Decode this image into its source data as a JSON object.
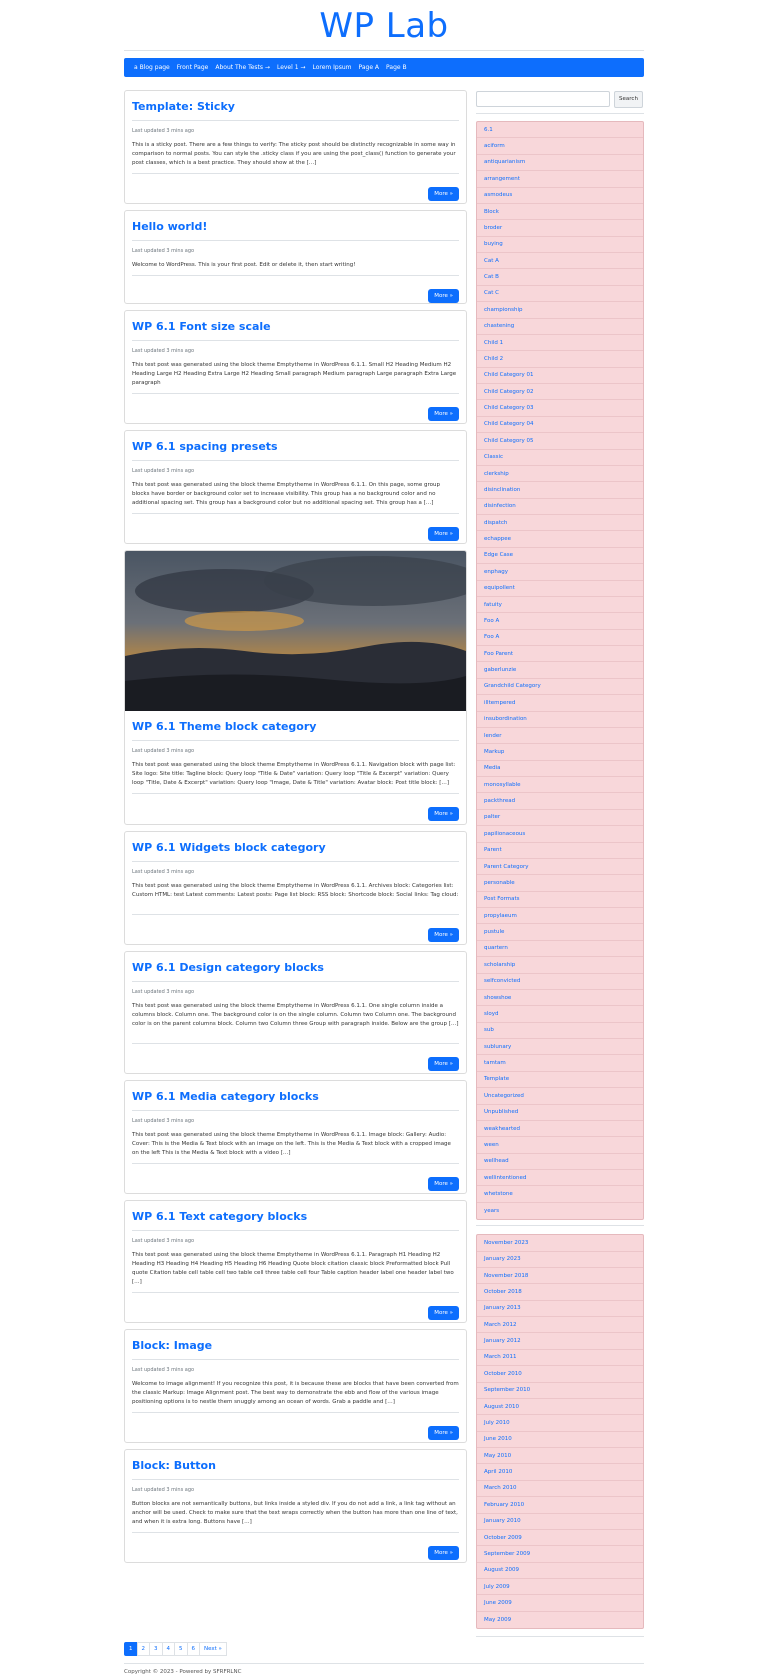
{
  "site": {
    "title": "WP Lab"
  },
  "nav": {
    "items": [
      "a Blog page",
      "Front Page",
      "About The Tests →",
      "Level 1 →",
      "Lorem Ipsum",
      "Page A",
      "Page B"
    ]
  },
  "posts": [
    {
      "title": "Template: Sticky",
      "meta": "Last updated 3 mins ago",
      "excerpt": "This is a sticky post. There are a few things to verify: The sticky post should be distinctly recognizable in some way in comparison to normal posts. You can style the .sticky class if you are using the post_class() function to generate your post classes, which is a best practice. They should show at the […]",
      "more": "More »"
    },
    {
      "title": "Hello world!",
      "meta": "Last updated 3 mins ago",
      "excerpt": "Welcome to WordPress. This is your first post. Edit or delete it, then start writing!",
      "more": "More »"
    },
    {
      "title": "WP 6.1 Font size scale",
      "meta": "Last updated 3 mins ago",
      "excerpt": "This test post was generated using the block theme Emptytheme in WordPress 6.1.1. Small H2 Heading Medium H2 Heading Large H2 Heading Extra Large H2 Heading Small paragraph Medium paragraph Large paragraph Extra Large paragraph",
      "more": "More »"
    },
    {
      "title": "WP 6.1 spacing presets",
      "meta": "Last updated 3 mins ago",
      "excerpt": "This test post was generated using the block theme Emptytheme in WordPress 6.1.1. On this page, some group blocks have border or background color set to increase visibility. This group has a no background color and no additional spacing set. This group has a background color but no additional spacing set. This group has a […]",
      "more": "More »"
    },
    {
      "title": "WP 6.1 Theme block category",
      "meta": "Last updated 3 mins ago",
      "excerpt": "This test post was generated using the block theme Emptytheme in WordPress 6.1.1. Navigation block with page list: Site logo: Site title: Tagline block: Query loop \"Title & Date\" variation: Query loop \"Title & Excerpt\" variation: Query loop \"Title, Date & Excerpt\" variation: Query loop \"Image, Date & Title\" variation: Avatar block: Post title block: […]",
      "more": "More »",
      "image": true
    },
    {
      "title": "WP 6.1 Widgets block category",
      "meta": "Last updated 3 mins ago",
      "excerpt": "This test post was generated using the block theme Emptytheme in WordPress 6.1.1. Archives block: Categories list: Custom HTML: test Latest comments: Latest posts: Page list block: RSS block: Shortcode block: Social links: Tag cloud:",
      "more": "More »"
    },
    {
      "title": "WP 6.1 Design category blocks",
      "meta": "Last updated 3 mins ago",
      "excerpt": "This test post was generated using the block theme Emptytheme in WordPress 6.1.1. One single column inside a columns block. Column one. The background color is on the single column. Column two Column one. The background color is on the parent columns block. Column two Column three Group with paragraph inside. Below are the group […]",
      "more": "More »"
    },
    {
      "title": "WP 6.1 Media category blocks",
      "meta": "Last updated 3 mins ago",
      "excerpt": "This test post was generated using the block theme Emptytheme in WordPress 6.1.1. Image block: Gallery: Audio: Cover: This is the Media & Text block with an image on the left. This is the Media & Text block with a cropped image on the left This is the Media & Text block with a video […]",
      "more": "More »"
    },
    {
      "title": "WP 6.1 Text category blocks",
      "meta": "Last updated 3 mins ago",
      "excerpt": "This test post was generated using the block theme Emptytheme in WordPress 6.1.1. Paragraph H1 Heading H2 Heading H3 Heading H4 Heading H5 Heading H6 Heading Quote block citation classic block Preformatted block Pull quote Citation table cell table cell two table cell three table cell four Table caption header label one header label two […]",
      "more": "More »"
    },
    {
      "title": "Block: Image",
      "meta": "Last updated 3 mins ago",
      "excerpt": "Welcome to image alignment! If you recognize this post, it is because these are blocks that have been converted from the classic Markup: Image Alignment post. The best way to demonstrate the ebb and flow of the various image positioning options is to nestle them snuggly among an ocean of words. Grab a paddle and […]",
      "more": "More »"
    },
    {
      "title": "Block: Button",
      "meta": "Last updated 3 mins ago",
      "excerpt": "Button blocks are not semantically buttons, but links inside a styled div.  If you do not add a link, a link tag without an anchor will be used. Check to make sure that the text wraps correctly when the button has more than one line of text, and when it is extra long. Buttons have […]",
      "more": "More »"
    }
  ],
  "search": {
    "placeholder": "",
    "button": "Search"
  },
  "categories": [
    "6.1",
    "aciform",
    "antiquarianism",
    "arrangement",
    "asmodeus",
    "Block",
    "broder",
    "buying",
    "Cat A",
    "Cat B",
    "Cat C",
    "championship",
    "chastening",
    "Child 1",
    "Child 2",
    "Child Category 01",
    "Child Category 02",
    "Child Category 03",
    "Child Category 04",
    "Child Category 05",
    "Classic",
    "clerkship",
    "disinclination",
    "disinfection",
    "dispatch",
    "echappee",
    "Edge Case",
    "enphagy",
    "equipollent",
    "fatuity",
    "Foo A",
    "Foo A",
    "Foo Parent",
    "gaberlunzie",
    "Grandchild Category",
    "illtempered",
    "insubordination",
    "lender",
    "Markup",
    "Media",
    "monosyllable",
    "packthread",
    "palter",
    "papilionaceous",
    "Parent",
    "Parent Category",
    "personable",
    "Post Formats",
    "propylaeum",
    "pustule",
    "quartern",
    "scholarship",
    "selfconvicted",
    "showshoe",
    "sloyd",
    "sub",
    "sublunary",
    "tamtam",
    "Template",
    "Uncategorized",
    "Unpublished",
    "weakhearted",
    "ween",
    "wellhead",
    "wellintentioned",
    "whetstone",
    "years"
  ],
  "archives": [
    "November 2023",
    "January 2023",
    "November 2018",
    "October 2018",
    "January 2013",
    "March 2012",
    "January 2012",
    "March 2011",
    "October 2010",
    "September 2010",
    "August 2010",
    "July 2010",
    "June 2010",
    "May 2010",
    "April 2010",
    "March 2010",
    "February 2010",
    "January 2010",
    "October 2009",
    "September 2009",
    "August 2009",
    "July 2009",
    "June 2009",
    "May 2009"
  ],
  "pagination": {
    "pages": [
      "1",
      "2",
      "3",
      "4",
      "5",
      "6"
    ],
    "next": "Next »",
    "current": "1"
  },
  "footer": {
    "text": "Copyright © 2023 - Powered by SFRFRLNC"
  },
  "colors": {
    "accent": "#0d6efd",
    "sidebar_bg": "#f8d7da"
  }
}
